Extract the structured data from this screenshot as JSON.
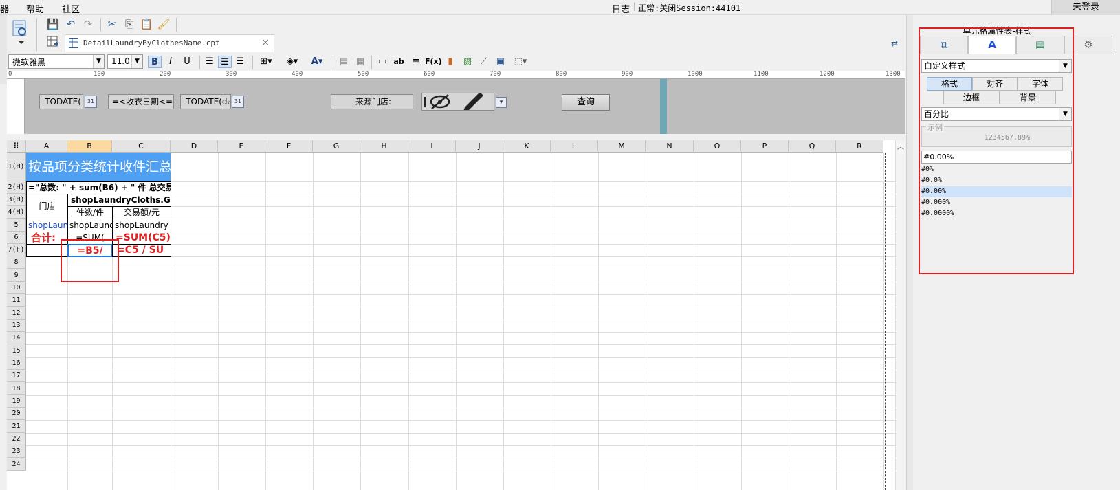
{
  "menu": {
    "partial": "器",
    "help": "帮助",
    "community": "社区",
    "log": "日志",
    "status": "正常:关闭Session:44101",
    "login": "未登录"
  },
  "toolbar": {
    "file_tab": "DetailLaundryByClothesName.cpt",
    "close_glyph": "×"
  },
  "format": {
    "font_name": "微软雅黑",
    "font_size": "11.0",
    "bold": "B",
    "italic": "I",
    "underline": "U",
    "ab_label": "ab",
    "fx_label": "F(x)"
  },
  "ruler": {
    "ticks": [
      "0",
      "100",
      "200",
      "300",
      "400",
      "500",
      "600",
      "700",
      "800",
      "900",
      "1000",
      "1100",
      "1200",
      "1300"
    ]
  },
  "params": {
    "date_from": "-TODATE(",
    "date_label": "=<收衣日期<=",
    "date_to": "-TODATE(da",
    "cal_label": "31",
    "store_label": "来源门店:",
    "query": "查询"
  },
  "grid": {
    "columns": [
      "A",
      "B",
      "C",
      "D",
      "E",
      "F",
      "G",
      "H",
      "I",
      "J",
      "K",
      "L",
      "M",
      "N",
      "O",
      "P",
      "Q",
      "R"
    ],
    "row_labels": [
      "1(H)",
      "2(H)",
      "3(H)",
      "4(H)",
      "5",
      "6",
      "7(F)",
      "8",
      "9",
      "10",
      "11",
      "12",
      "13",
      "14",
      "15",
      "16",
      "17",
      "18",
      "19",
      "20",
      "21",
      "22",
      "23",
      "24"
    ],
    "corner": "⠿",
    "cells": {
      "a1": "按品项分类统计收件汇总",
      "a2": "=\"总数: \" + sum(B6) + \" 件 总交易",
      "b3": "shopLaundryCloths.G(",
      "a3": "门店",
      "b4": "件数/件",
      "c4": "交易额/元",
      "a5": "shopLaun",
      "b5": "shopLaund",
      "c5": "shopLaundry",
      "a6": "合计:",
      "b6": "=SUM(",
      "c6": "=SUM(C5)",
      "b7": "=B5/",
      "c7": "=C5 / SU"
    }
  },
  "panel": {
    "title": "单元格属性表-样式",
    "style_combo": "自定义样式",
    "subtabs": [
      "格式",
      "对齐",
      "字体",
      "边框",
      "背景"
    ],
    "format_combo": "百分比",
    "sample_label": "示例",
    "sample_value": "1234567.89%",
    "pattern": "#0.00%",
    "patterns": [
      "#0%",
      "#0.0%",
      "#0.00%",
      "#0.000%",
      "#0.0000%"
    ],
    "selected_pattern": "#0.00%"
  },
  "colors": {
    "header_blue": "#4f9ff2",
    "formula_red": "#e02020",
    "highlight_box": "#e02020"
  }
}
